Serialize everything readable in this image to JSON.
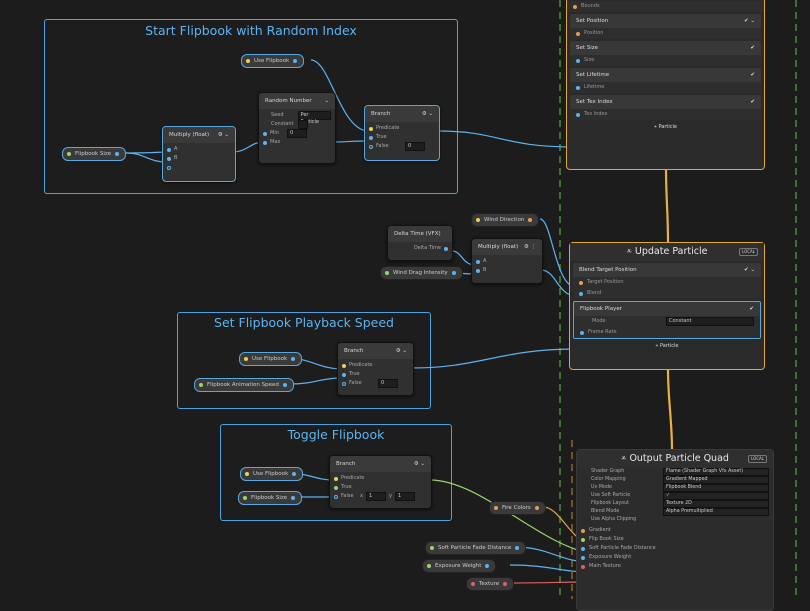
{
  "groups": {
    "random_index": {
      "title": "Start Flipbook with Random Index"
    },
    "playback_speed": {
      "title": "Set Flipbook Playback Speed"
    },
    "toggle": {
      "title": "Toggle Flipbook"
    }
  },
  "properties": {
    "use_flipbook_1": "Use Flipbook",
    "flipbook_size_1": "Flipbook Size",
    "wind_direction": "Wind Direction",
    "wind_drag": "Wind Drag Intensity",
    "use_flipbook_2": "Use Flipbook",
    "flipbook_anim_speed": "Flipbook Animation Speed",
    "use_flipbook_3": "Use Flipbook",
    "flipbook_size_2": "Flipbook Size",
    "fire_colors": "Fire Colors",
    "soft_particle": "Soft Particle Fade Distance",
    "exposure": "Exposure Weight",
    "texture": "Texture"
  },
  "nodes": {
    "multiply1": {
      "title": "Multiply (float)",
      "a": "A",
      "b": "B"
    },
    "random": {
      "title": "Random Number",
      "seed": "Seed",
      "seed_val": "Per Particle",
      "constant": "Constant",
      "min": "Min",
      "min_val": "0",
      "max": "Max"
    },
    "branch1": {
      "title": "Branch",
      "predicate": "Predicate",
      "true_lbl": "True",
      "false_lbl": "False",
      "false_val": "0"
    },
    "delta": {
      "title": "Delta Time (VFX)",
      "out": "Delta Time"
    },
    "multiply2": {
      "title": "Multiply (float)",
      "a": "A",
      "b": "B"
    },
    "branch2": {
      "title": "Branch",
      "predicate": "Predicate",
      "true_lbl": "True",
      "false_lbl": "False",
      "false_val": "0"
    },
    "branch3": {
      "title": "Branch",
      "predicate": "Predicate",
      "true_lbl": "True",
      "false_lbl": "False",
      "x": "x",
      "x_val": "1",
      "y": "y",
      "y_val": "1"
    }
  },
  "init_context": {
    "bounds": "Bounds",
    "blocks": [
      {
        "title": "Set Position",
        "row": "Position"
      },
      {
        "title": "Set Size",
        "row": "Size"
      },
      {
        "title": "Set Lifetime",
        "row": "Lifetime"
      },
      {
        "title": "Set Tex Index",
        "row": "Tex Index"
      }
    ],
    "footer": "Particle"
  },
  "update_context": {
    "title": "Update Particle",
    "badge": "LOCAL",
    "blend": {
      "title": "Blend Target Position",
      "row1": "Target Position",
      "row2": "Blend"
    },
    "flipbook": {
      "title": "Flipbook Player",
      "mode": "Mode",
      "mode_val": "Constant",
      "row": "Frame Rate"
    },
    "footer": "Particle"
  },
  "output_context": {
    "title": "Output Particle Quad",
    "badge": "LOCAL",
    "settings": [
      {
        "k": "Shader Graph",
        "v": "Flame (Shader Graph Vfx Asset)"
      },
      {
        "k": "Color Mapping",
        "v": "Gradient Mapped"
      },
      {
        "k": "Uv Mode",
        "v": "Flipbook Blend"
      },
      {
        "k": "Use Soft Particle",
        "v": "✓"
      },
      {
        "k": "Flipbook Layout",
        "v": "Texture 2D"
      },
      {
        "k": "Blend Mode",
        "v": "Alpha Premultiplied"
      },
      {
        "k": "Use Alpha Clipping",
        "v": ""
      }
    ],
    "inputs": [
      "Gradient",
      "Flip Book Size",
      "Soft Particle Fade Distance",
      "Exposure Weight",
      "Main Texture"
    ]
  },
  "colors": {
    "group_border": "#4aa3df",
    "context_border": "#e0a93a",
    "edge_blue": "#5db3f0",
    "edge_orange": "#e8b040",
    "dash_green": "#4e8a3a",
    "dash_orange": "#a87a2a"
  }
}
